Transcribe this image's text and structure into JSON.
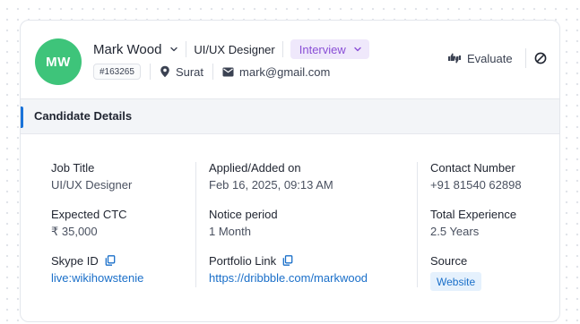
{
  "candidate": {
    "initials": "MW",
    "name": "Mark Wood",
    "designation": "UI/UX Designer",
    "stage": "Interview",
    "id": "#163265",
    "location": "Surat",
    "email": "mark@gmail.com"
  },
  "actions": {
    "evaluate_label": "Evaluate"
  },
  "section": {
    "title": "Candidate Details"
  },
  "details": {
    "job_title": {
      "label": "Job Title",
      "value": "UI/UX Designer"
    },
    "expected_ctc": {
      "label": "Expected CTC",
      "value": "₹ 35,000"
    },
    "skype_id": {
      "label": "Skype ID",
      "value": "live:wikihowstenie"
    },
    "applied_on": {
      "label": "Applied/Added on",
      "value": "Feb 16, 2025, 09:13 AM"
    },
    "notice_period": {
      "label": "Notice period",
      "value": "1 Month"
    },
    "portfolio_link": {
      "label": "Portfolio Link",
      "value": "https://dribbble.com/markwood"
    },
    "contact_number": {
      "label": "Contact Number",
      "value": "+91 81540 62898"
    },
    "total_experience": {
      "label": "Total Experience",
      "value": "2.5 Years"
    },
    "source": {
      "label": "Source",
      "value": "Website"
    }
  },
  "colors": {
    "avatar": "#3ec47a",
    "stage_bg": "#efe8fb",
    "stage_text": "#8a4fd6",
    "accent": "#1a73d9",
    "link": "#1a6fc9"
  },
  "icons": [
    "chevron-down-icon",
    "location-pin-icon",
    "mail-icon",
    "thumbs-up-down-icon",
    "block-icon",
    "copy-icon"
  ]
}
